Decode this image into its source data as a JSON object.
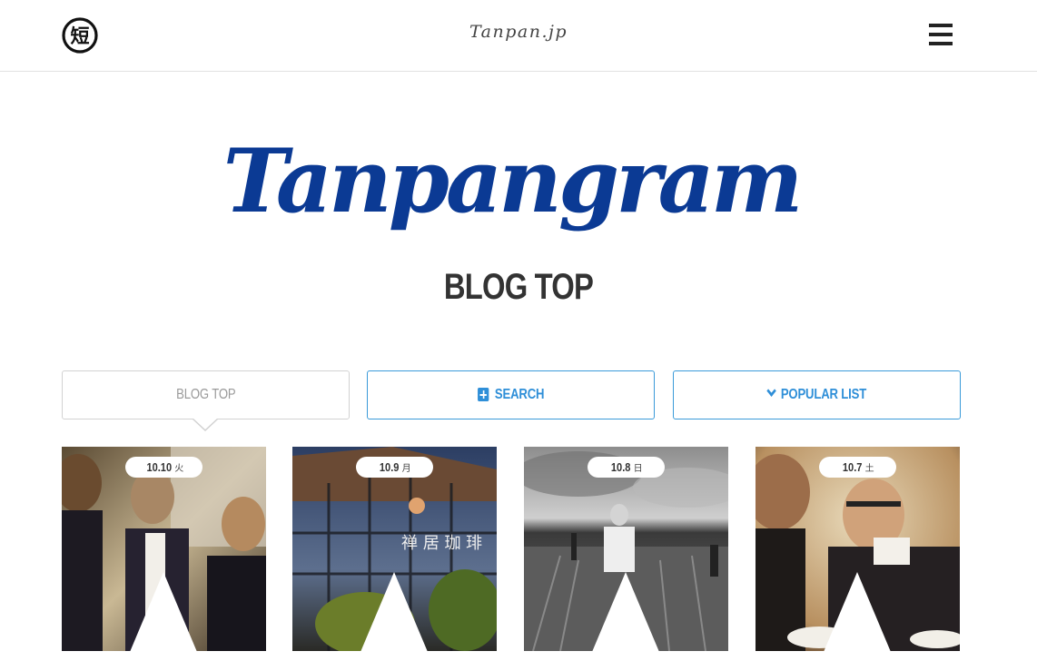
{
  "header": {
    "site_name": "Tanpan.jp",
    "logo_glyph": "短",
    "logo_icon": "tanpan-logo-icon",
    "menu_icon": "hamburger-menu-icon"
  },
  "brand": {
    "wordmark": "Tanpangram",
    "color": "#0b3a94"
  },
  "page_title": "BLOG TOP",
  "tabs": [
    {
      "label": "BLOG TOP",
      "active": true,
      "icon": null
    },
    {
      "label": "SEARCH",
      "active": false,
      "icon": "plus-icon"
    },
    {
      "label": "POPULAR LIST",
      "active": false,
      "icon": "chevron-down-icon"
    }
  ],
  "accent_color": "#2f8fd8",
  "posts": [
    {
      "date": "10.10",
      "weekday": "火"
    },
    {
      "date": "10.9",
      "weekday": "月"
    },
    {
      "date": "10.8",
      "weekday": "日"
    },
    {
      "date": "10.7",
      "weekday": "土"
    }
  ]
}
